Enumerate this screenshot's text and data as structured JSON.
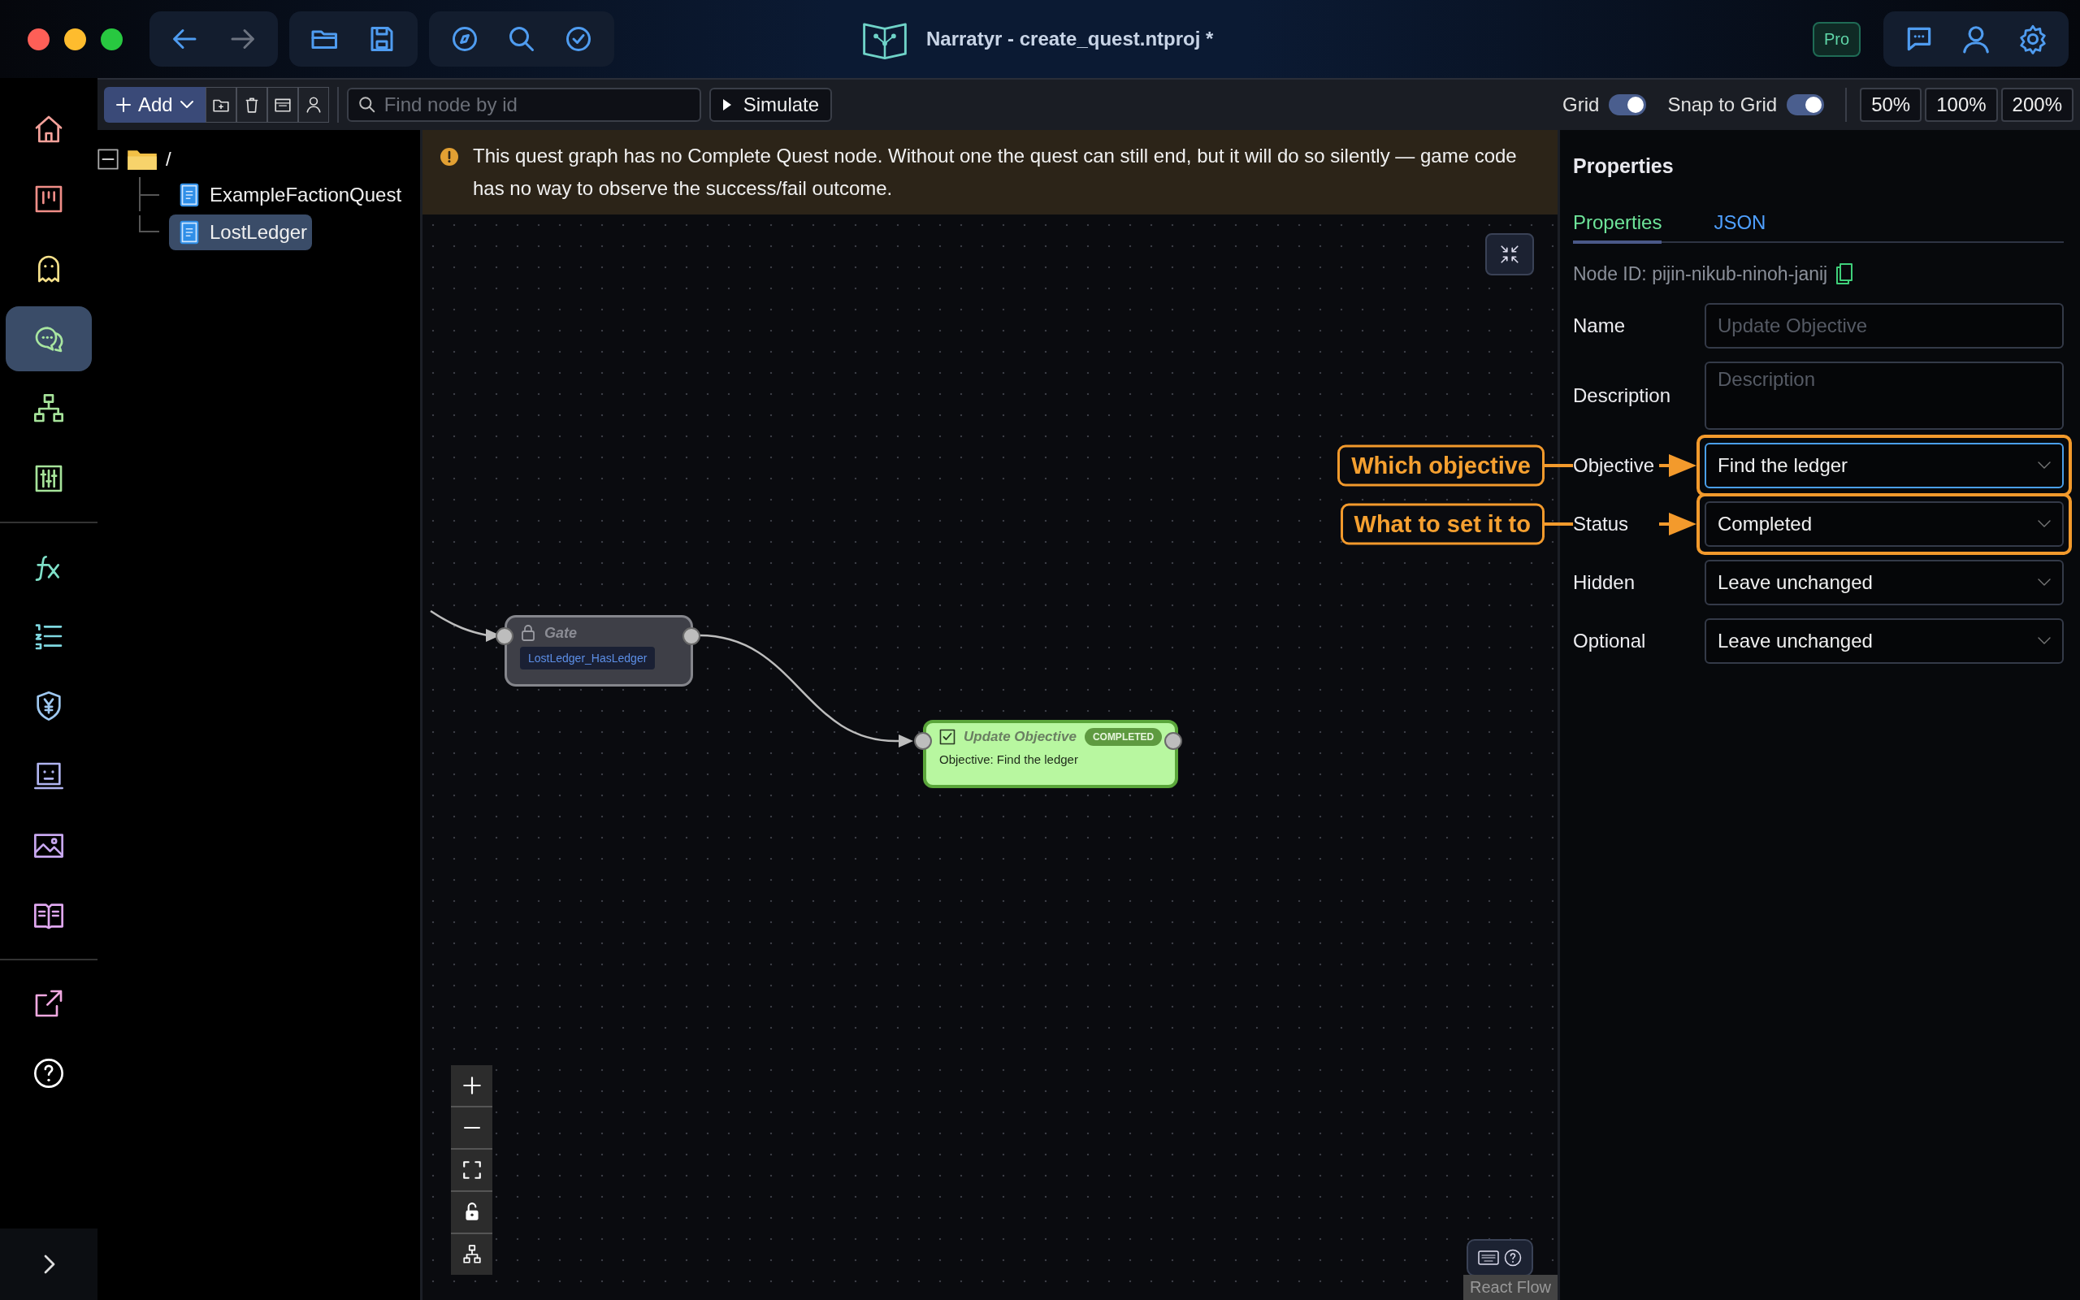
{
  "window": {
    "title": "Narratyr - create_quest.ntproj *",
    "badge": "Pro"
  },
  "sidebar": {
    "items": [
      {
        "selected": false
      },
      {
        "selected": false
      },
      {
        "selected": false
      },
      {
        "selected": true
      },
      {
        "selected": false
      },
      {
        "selected": false
      },
      {
        "selected": false
      },
      {
        "selected": false
      },
      {
        "selected": false
      },
      {
        "selected": false
      },
      {
        "selected": false
      },
      {
        "selected": false
      },
      {
        "selected": false
      },
      {
        "selected": false
      }
    ]
  },
  "toolbar": {
    "add": "Add",
    "search": {
      "placeholder": "Find node by id"
    },
    "simulate": "Simulate",
    "toggles": [
      {
        "label": "Grid",
        "on": true
      },
      {
        "label": "Snap to Grid",
        "on": true
      }
    ],
    "zoom_levels": [
      "50%",
      "100%",
      "200%"
    ]
  },
  "tree": {
    "root": {
      "label": "/",
      "expanded": true,
      "children": [
        {
          "label": "ExampleFactionQuest",
          "selected": false
        },
        {
          "label": "LostLedger",
          "selected": true
        }
      ]
    }
  },
  "banner": {
    "text": "This quest graph has no Complete Quest node. Without one the quest can still end, but it will do so silently — game code has no way to observe the success/fail outcome."
  },
  "canvas": {
    "nodes": [
      {
        "kind": "gate",
        "title": "Gate",
        "condition": "LostLedger_HasLedger"
      },
      {
        "kind": "update_objective",
        "title": "Update Objective",
        "badge": "COMPLETED",
        "body": "Objective: Find the ledger"
      }
    ],
    "attribution": "React Flow"
  },
  "properties": {
    "title": "Properties",
    "tabs": [
      {
        "label": "Properties",
        "selected": true
      },
      {
        "label": "JSON",
        "selected": false
      }
    ],
    "node_id": "Node ID: pijin-nikub-ninoh-janij",
    "fields": [
      {
        "label": "Name",
        "kind": "text",
        "placeholder": "Update Objective",
        "focused": false
      },
      {
        "label": "Description",
        "kind": "textarea",
        "placeholder": "Description",
        "focused": false
      },
      {
        "label": "Objective",
        "kind": "select",
        "value": "Find the ledger",
        "focused": true,
        "callout": "Which objective"
      },
      {
        "label": "Status",
        "kind": "select",
        "value": "Completed",
        "focused": false,
        "callout": "What to set it to"
      },
      {
        "label": "Hidden",
        "kind": "select",
        "value": "Leave unchanged",
        "focused": false
      },
      {
        "label": "Optional",
        "kind": "select",
        "value": "Leave unchanged",
        "focused": false
      }
    ]
  }
}
